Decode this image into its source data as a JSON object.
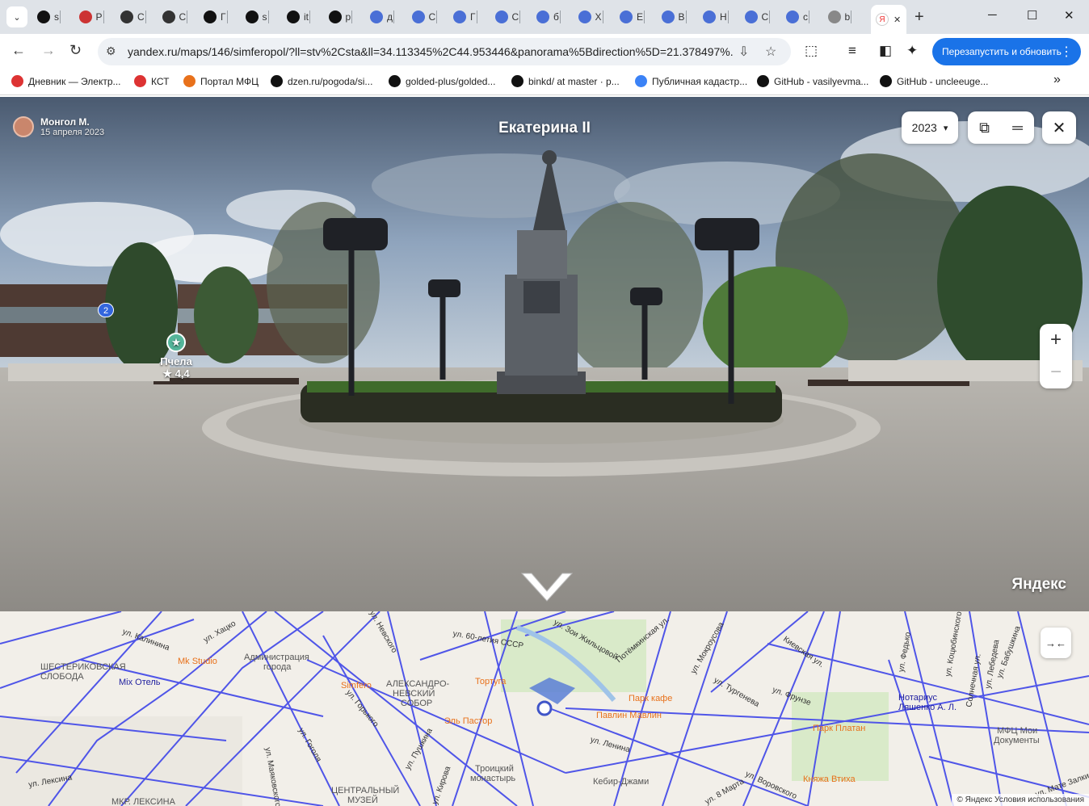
{
  "browser": {
    "tabs": [
      {
        "label": "s",
        "icon": "bird-icon"
      },
      {
        "label": "P",
        "icon": "colorful-icon"
      },
      {
        "label": "C",
        "icon": "screen-icon"
      },
      {
        "label": "C",
        "icon": "screen-icon"
      },
      {
        "label": "Г",
        "icon": "r-icon"
      },
      {
        "label": "s",
        "icon": "bird-icon"
      },
      {
        "label": "it",
        "icon": "bird-icon"
      },
      {
        "label": "p",
        "icon": "bird-icon"
      },
      {
        "label": "д",
        "icon": "target-icon"
      },
      {
        "label": "С",
        "icon": "target-icon"
      },
      {
        "label": "Г",
        "icon": "target-icon"
      },
      {
        "label": "С",
        "icon": "target-icon"
      },
      {
        "label": "б",
        "icon": "target-icon"
      },
      {
        "label": "Х",
        "icon": "target-icon"
      },
      {
        "label": "Е",
        "icon": "target-icon"
      },
      {
        "label": "В",
        "icon": "target-icon"
      },
      {
        "label": "Н",
        "icon": "target-icon"
      },
      {
        "label": "С",
        "icon": "target-icon"
      },
      {
        "label": "с",
        "icon": "target-icon"
      },
      {
        "label": "b",
        "icon": "globe-icon"
      }
    ],
    "active_tab": {
      "label": "Я",
      "close": "✕"
    },
    "new_tab": "+",
    "window_buttons": {
      "minimize": "─",
      "maximize": "☐",
      "close": "✕"
    },
    "url": "yandex.ru/maps/146/simferopol/?ll=stv%2Csta&ll=34.113345%2C44.953446&panorama%5Bdirection%5D=21.378497%...",
    "relaunch_label": "Перезапустить и обновить",
    "bookmarks": [
      {
        "label": "Дневник — Электр...",
        "color": "#d33"
      },
      {
        "label": "КСТ",
        "color": "#d33"
      },
      {
        "label": "Портал МФЦ",
        "color": "#e8711b"
      },
      {
        "label": "dzen.ru/pogoda/si...",
        "color": "#111"
      },
      {
        "label": "golded-plus/golded...",
        "color": "#111"
      },
      {
        "label": "binkd/ at master · p...",
        "color": "#111"
      },
      {
        "label": "Публичная кадастр...",
        "color": "#3b82f6"
      },
      {
        "label": "GitHub - vasilyevma...",
        "color": "#111"
      },
      {
        "label": "GitHub - uncleeuge...",
        "color": "#111"
      }
    ],
    "bookmarks_more": "»"
  },
  "panorama": {
    "author_name": "Монгол М.",
    "date": "15 апреля 2023",
    "title": "Екатерина II",
    "year": "2023",
    "year_caret": "▾",
    "zoom_in": "+",
    "zoom_out": "−",
    "close": "✕",
    "brand": "Яндекс",
    "poi_name": "Пчела",
    "poi_rating": "★ 4,4",
    "badge": "2"
  },
  "map": {
    "collapse_icon": "→←",
    "labels": [
      {
        "text": "ШЕСТЕРИКОВСКАЯ",
        "cls": "gray"
      },
      {
        "text": "СЛОБОДА",
        "cls": "gray"
      },
      {
        "text": "Mix Отель",
        "cls": ""
      },
      {
        "text": "Mk Studio",
        "cls": "orange"
      },
      {
        "text": "Администрация",
        "cls": "gray"
      },
      {
        "text": "города",
        "cls": "gray"
      },
      {
        "text": "Simfero",
        "cls": "orange"
      },
      {
        "text": "АЛЕКСАНДРО-",
        "cls": "gray"
      },
      {
        "text": "НЕВСКИЙ",
        "cls": "gray"
      },
      {
        "text": "СОБОР",
        "cls": "gray"
      },
      {
        "text": "Тортуга",
        "cls": "orange"
      },
      {
        "text": "Эль Пастор",
        "cls": "orange"
      },
      {
        "text": "Парк кафе",
        "cls": "orange"
      },
      {
        "text": "Павлин Мавлин",
        "cls": "orange"
      },
      {
        "text": "Нотариус",
        "cls": ""
      },
      {
        "text": "Ляшенко А. Л.",
        "cls": ""
      },
      {
        "text": "Парк Платан",
        "cls": "orange"
      },
      {
        "text": "МФЦ Мои",
        "cls": "gray"
      },
      {
        "text": "Документы",
        "cls": "gray"
      },
      {
        "text": "Княжа Втиха",
        "cls": "orange"
      },
      {
        "text": "Троицкий",
        "cls": "gray"
      },
      {
        "text": "монастырь",
        "cls": "gray"
      },
      {
        "text": "Кебир-Джами",
        "cls": "gray"
      },
      {
        "text": "ЦЕНТРАЛЬНЫЙ",
        "cls": "gray"
      },
      {
        "text": "МУЗЕЙ",
        "cls": "gray"
      },
      {
        "text": "МКР. ЛЕКСИНА",
        "cls": "gray"
      }
    ],
    "streets": [
      "ул. Калинина",
      "ул. Хацко",
      "ул. Невского",
      "ул. Горького",
      "ул. Гоголя",
      "ул. Кирова",
      "ул. Ленина",
      "ул. Зои Жильцовой",
      "Потёмкинская ул.",
      "ул. Мокроусова",
      "ул. Тургенева",
      "Киевская ул.",
      "ул. Фрунзе",
      "ул. Федько",
      "ул. Коцюбинского",
      "Солнечная ул.",
      "ул. Лебедева",
      "ул. Бабушкина",
      "ул. Воровского",
      "ул. Лексина",
      "ул. Маяковского",
      "ул. 60-летия СССР",
      "ул. Пушкина",
      "ул. 8 Марта",
      "ул. Мате Залки"
    ],
    "copyright": "© Яндекс   Условия использования"
  }
}
